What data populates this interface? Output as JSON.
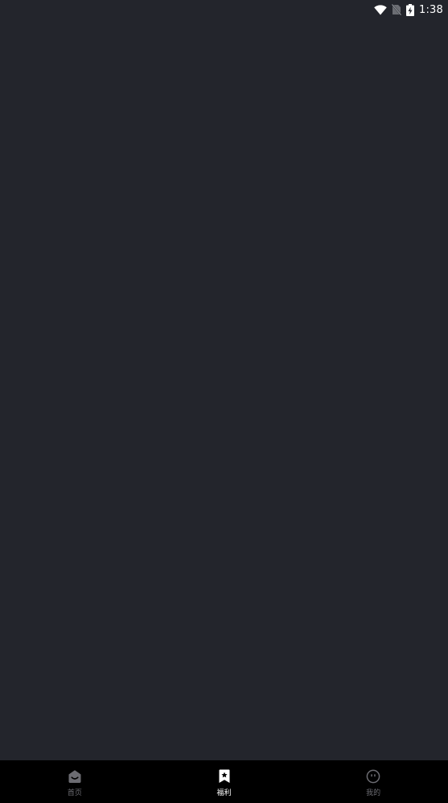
{
  "status_bar": {
    "time": "1:38",
    "icons": [
      "wifi-icon",
      "no-sim-icon",
      "battery-charging-icon"
    ]
  },
  "colors": {
    "background": "#23252c",
    "tab_bar": "#000000",
    "tab_active": "#ffffff",
    "tab_inactive": "#6c6c72"
  },
  "tab_bar": {
    "active_tab": "tab-welfare",
    "tabs": [
      {
        "label": "首页",
        "icon": "home-icon"
      },
      {
        "label": "福利",
        "icon": "bookmark-star-icon"
      },
      {
        "label": "我的",
        "icon": "face-icon"
      }
    ]
  }
}
